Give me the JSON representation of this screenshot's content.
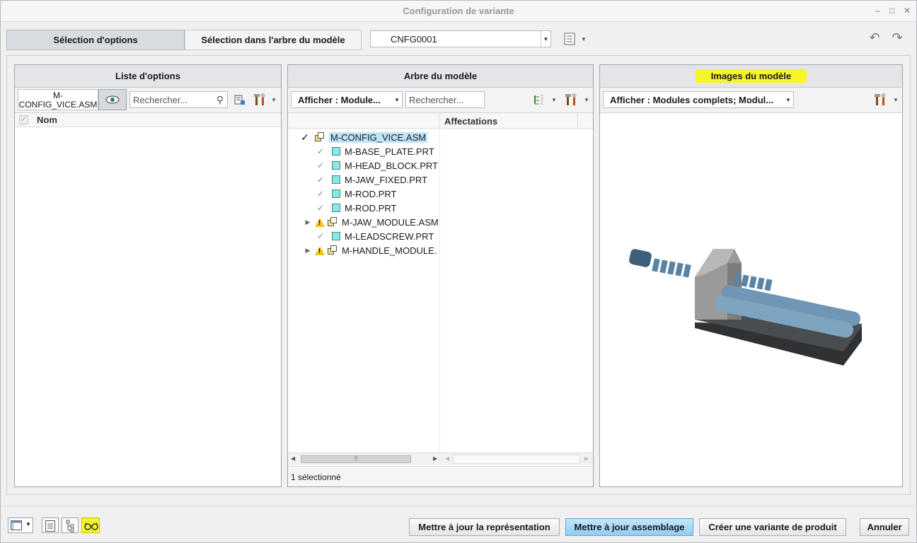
{
  "window": {
    "title": "Configuration de variante"
  },
  "tabs": [
    {
      "label": "Sélection d'options"
    },
    {
      "label": "Sélection dans l'arbre du modèle"
    }
  ],
  "config_select": {
    "value": "CNFG0001"
  },
  "panels": {
    "options": {
      "title": "Liste d'options",
      "model_chip": "M-\nCONFIG_VICE.ASM",
      "search_placeholder": "Rechercher...",
      "column_name": "Nom"
    },
    "tree": {
      "title": "Arbre du modèle",
      "show_dropdown": "Afficher : Module...",
      "search_placeholder": "Rechercher...",
      "column_assignments": "Affectations",
      "items": [
        {
          "name": "M-CONFIG_VICE.ASM",
          "kind": "asm",
          "selected": true
        },
        {
          "name": "M-BASE_PLATE.PRT",
          "kind": "prt"
        },
        {
          "name": "M-HEAD_BLOCK.PRT",
          "kind": "prt"
        },
        {
          "name": "M-JAW_FIXED.PRT",
          "kind": "prt"
        },
        {
          "name": "M-ROD.PRT",
          "kind": "prt"
        },
        {
          "name": "M-ROD.PRT",
          "kind": "prt"
        },
        {
          "name": "M-JAW_MODULE.ASM",
          "kind": "module",
          "warning": true
        },
        {
          "name": "M-LEADSCREW.PRT",
          "kind": "prt"
        },
        {
          "name": "M-HANDLE_MODULE.",
          "kind": "module",
          "warning": true
        }
      ],
      "status": "1 sélectionné"
    },
    "images": {
      "title": "Images du modèle",
      "show_dropdown": "Afficher : Modules complets; Modul..."
    }
  },
  "buttons": {
    "update_representation": "Mettre à jour la représentation",
    "update_assembly": "Mettre à jour assemblage",
    "create_variant": "Créer une variante de produit",
    "cancel": "Annuler"
  },
  "colors": {
    "highlight": "#f5f52a",
    "primary_button": "#8fcdf3",
    "selection": "#bfe3f7"
  }
}
